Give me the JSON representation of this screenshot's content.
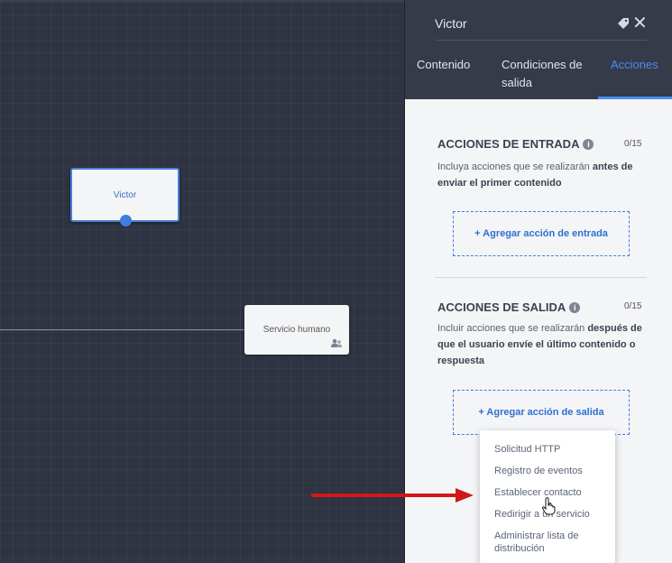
{
  "canvas": {
    "nodes": {
      "victor": "Victor",
      "servicio": "Servicio humano"
    }
  },
  "panel": {
    "title": "Victor",
    "tabs": {
      "contenido": "Contenido",
      "condiciones": "Condiciones de salida",
      "acciones": "Acciones"
    },
    "entrada": {
      "title": "ACCIONES DE ENTRADA",
      "count": "0/15",
      "desc_pre": "Incluya acciones que se realizarán ",
      "desc_bold": "antes de enviar el primer contenido",
      "button": "+ Agregar acción de entrada"
    },
    "salida": {
      "title": "ACCIONES DE SALIDA",
      "count": "0/15",
      "desc_pre": "Incluir acciones que se realizarán ",
      "desc_bold": "después de que el usuario envíe el último contenido o respuesta",
      "button": "+ Agregar acción de salida"
    },
    "menu": [
      "Solicitud HTTP",
      "Registro de eventos",
      "Establecer contacto",
      "Redirigir a un servicio",
      "Administrar lista de distribución"
    ]
  },
  "colors": {
    "accent": "#4b8ef0",
    "canvas_bg": "#2e3442",
    "annotation_arrow": "#d01818"
  }
}
